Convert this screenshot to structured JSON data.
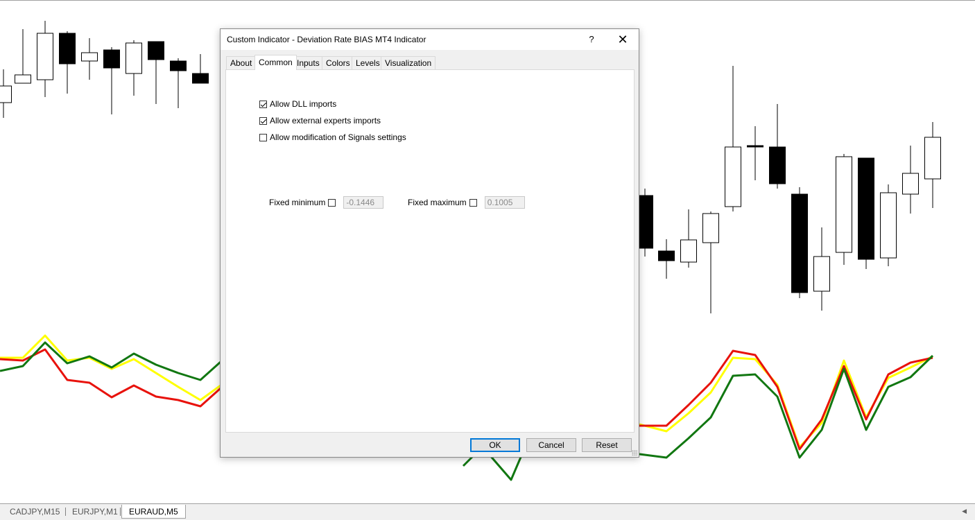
{
  "dialog": {
    "title": "Custom Indicator - Deviation Rate BIAS MT4 Indicator",
    "help_label": "?",
    "close_label": "✕",
    "tabs": [
      {
        "label": "About",
        "active": false
      },
      {
        "label": "Common",
        "active": true
      },
      {
        "label": "Inputs",
        "active": false
      },
      {
        "label": "Colors",
        "active": false
      },
      {
        "label": "Levels",
        "active": false
      },
      {
        "label": "Visualization",
        "active": false
      }
    ],
    "common": {
      "options": [
        {
          "label": "Allow DLL imports",
          "checked": true
        },
        {
          "label": "Allow external experts imports",
          "checked": true
        },
        {
          "label": "Allow modification of Signals settings",
          "checked": false
        }
      ],
      "fixed_minimum": {
        "label": "Fixed minimum",
        "checked": false,
        "value": "-0.1446"
      },
      "fixed_maximum": {
        "label": "Fixed maximum",
        "checked": false,
        "value": "0.1005"
      }
    },
    "buttons": {
      "ok": "OK",
      "cancel": "Cancel",
      "reset": "Reset"
    }
  },
  "chart_tabs": [
    {
      "label": "CADJPY,M15",
      "active": false
    },
    {
      "label": "EURJPY,M1",
      "active": false
    },
    {
      "label": "EURAUD,M5",
      "active": true
    }
  ],
  "colors": {
    "indicator_red": "#e8120c",
    "indicator_yellow": "#ffff00",
    "indicator_green": "#117711",
    "bear_candle": "#000000",
    "bull_candle": "#ffffff",
    "dialog_accent": "#0078d7"
  },
  "icons": {
    "scroll_left": "triangle-left-icon"
  }
}
